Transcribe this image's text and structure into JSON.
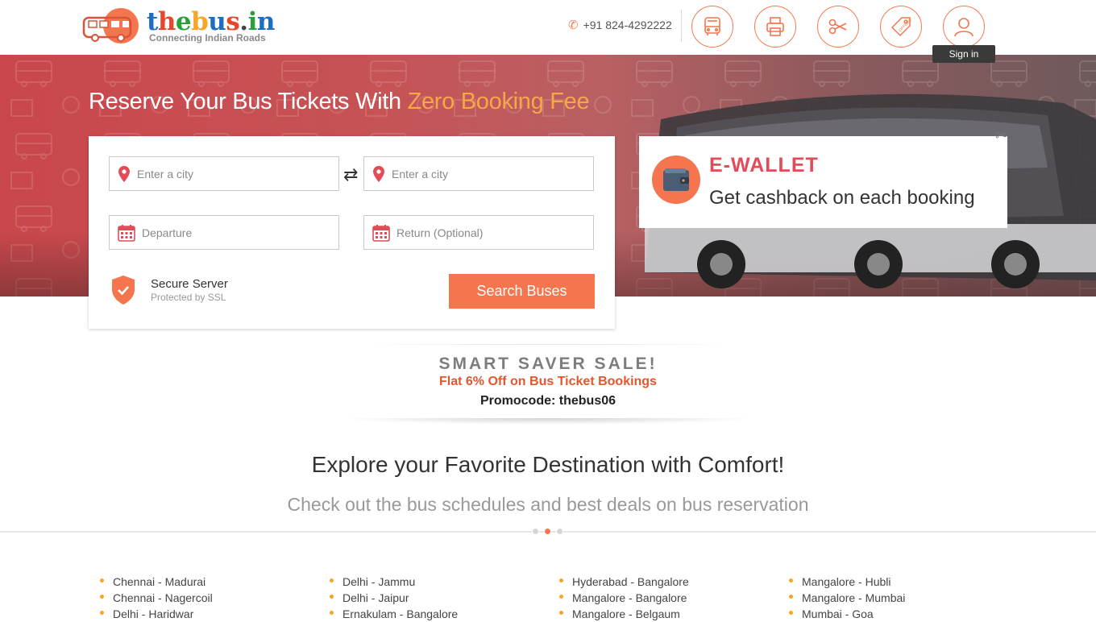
{
  "header": {
    "logo_text": "thebus.in",
    "logo_tagline": "Connecting Indian Roads",
    "phone": "+91 824-4292222",
    "nav_buttons": [
      {
        "icon": "bus-icon"
      },
      {
        "icon": "printer-icon"
      },
      {
        "icon": "scissors-icon"
      },
      {
        "icon": "offers-tag-icon"
      },
      {
        "icon": "user-icon"
      }
    ],
    "tooltip": "Sign in"
  },
  "hero": {
    "title_prefix": "Reserve Your Bus Tickets With ",
    "title_highlight": "Zero Booking Fee"
  },
  "search": {
    "from_placeholder": "Enter a city",
    "to_placeholder": "Enter a city",
    "departure_placeholder": "Departure",
    "return_placeholder": "Return (Optional)",
    "secure_title": "Secure Server",
    "secure_sub": "Protected by SSL",
    "search_label": "Search Buses"
  },
  "wallet": {
    "title": "E-WALLET",
    "subtitle": "Get cashback on each booking"
  },
  "promo": {
    "title": "SMART SAVER SALE!",
    "subtitle": "Flat 6% Off on Bus Ticket Bookings",
    "code": "Promocode: thebus06"
  },
  "explore": {
    "title": "Explore your Favorite Destination with Comfort!",
    "subtitle": "Check out the bus schedules and best deals on bus reservation"
  },
  "routes": [
    [
      "Chennai - Madurai",
      "Chennai - Nagercoil",
      "Delhi - Haridwar"
    ],
    [
      "Delhi - Jammu",
      "Delhi - Jaipur",
      "Ernakulam - Bangalore"
    ],
    [
      "Hyderabad - Bangalore",
      "Mangalore - Bangalore",
      "Mangalore - Belgaum"
    ],
    [
      "Mangalore - Hubli",
      "Mangalore - Mumbai",
      "Mumbai - Goa"
    ]
  ],
  "colors": {
    "accent": "#f4754e",
    "wallet_title": "#e24b57",
    "promo_subtitle": "#e2572d",
    "highlight": "#f5a74a"
  }
}
